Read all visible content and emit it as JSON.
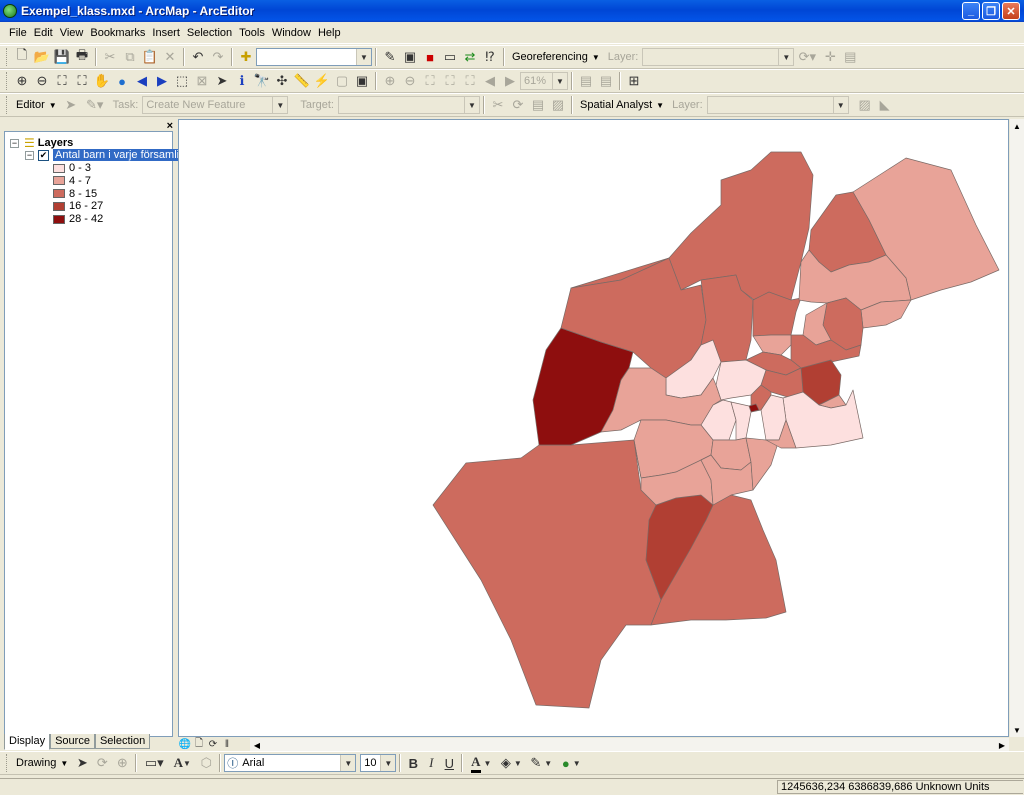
{
  "window": {
    "title": "Exempel_klass.mxd - ArcMap - ArcEditor"
  },
  "menu": [
    "File",
    "Edit",
    "View",
    "Bookmarks",
    "Insert",
    "Selection",
    "Tools",
    "Window",
    "Help"
  ],
  "standard_toolbar": {
    "georeferencing_label": "Georeferencing",
    "layer_label": "Layer:"
  },
  "tools_toolbar": {
    "zoom_percent": "61%"
  },
  "editor_toolbar": {
    "editor_label": "Editor",
    "task_label": "Task:",
    "task_value": "Create New Feature",
    "target_label": "Target:",
    "spatial_analyst_label": "Spatial Analyst",
    "layer_label": "Layer:"
  },
  "toc": {
    "root_label": "Layers",
    "layer_name": "Antal barn i varje församling",
    "classes": [
      {
        "label": "0 - 3",
        "color": "#fde0df"
      },
      {
        "label": "4 - 7",
        "color": "#e8a398"
      },
      {
        "label": "8 - 15",
        "color": "#cd6b5e"
      },
      {
        "label": "16 - 27",
        "color": "#b13f33"
      },
      {
        "label": "28 - 42",
        "color": "#8e0e0e"
      }
    ],
    "tabs": [
      "Display",
      "Source",
      "Selection"
    ]
  },
  "draw_toolbar": {
    "drawing_label": "Drawing",
    "font_name": "Arial",
    "font_size": "10",
    "bold_label": "B",
    "italic_label": "I",
    "underline_label": "U",
    "text_tool_label": "A"
  },
  "status": {
    "coordinates": "1245636,234  6386839,686 Unknown Units"
  }
}
